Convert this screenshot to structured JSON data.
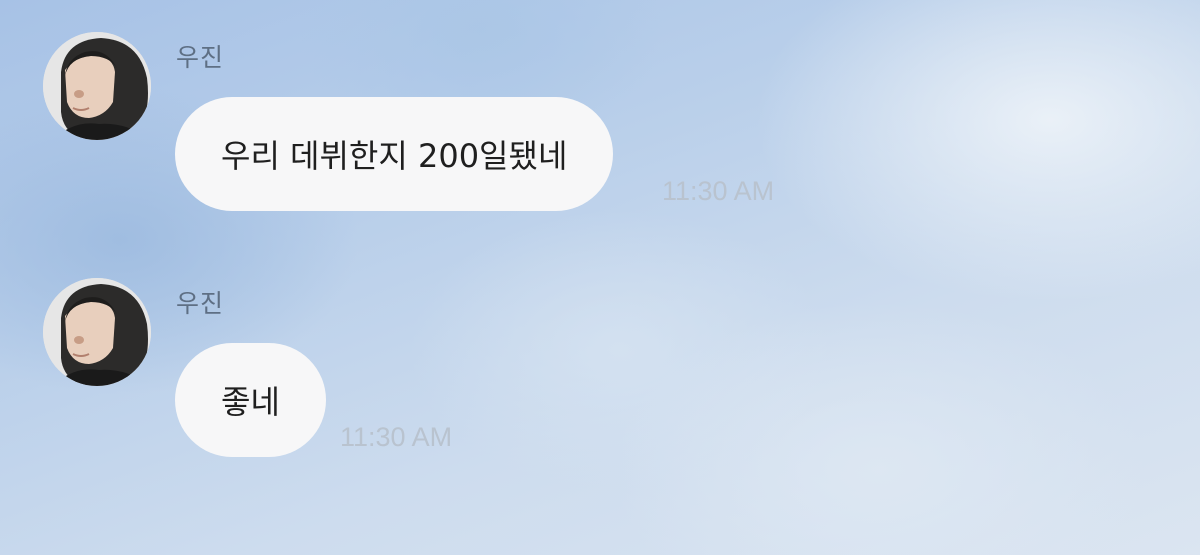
{
  "messages": [
    {
      "sender": "우진",
      "text": "우리 데뷔한지 200일됐네",
      "time": "11:30 AM",
      "avatar_icon": "profile-photo"
    },
    {
      "sender": "우진",
      "text": "좋네",
      "time": "11:30 AM",
      "avatar_icon": "profile-photo"
    }
  ],
  "colors": {
    "bubble": "#f7f7f8",
    "sender_name": "#5e6f84",
    "timestamp": "#b9c3cf",
    "background": "#b9cfea"
  }
}
